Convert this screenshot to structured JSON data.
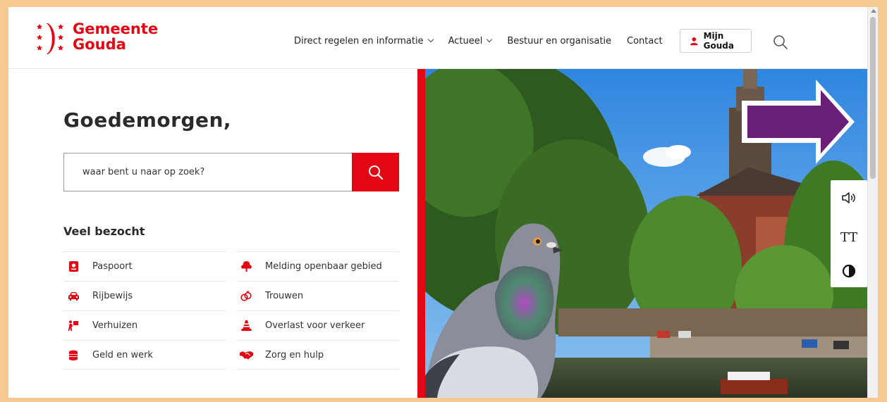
{
  "site": {
    "logo_line1": "Gemeente",
    "logo_line2": "Gouda",
    "brand_color": "#e30613"
  },
  "nav": {
    "items": [
      {
        "label": "Direct regelen en informatie",
        "has_dropdown": true
      },
      {
        "label": "Actueel",
        "has_dropdown": true
      },
      {
        "label": "Bestuur en organisatie",
        "has_dropdown": false
      },
      {
        "label": "Contact",
        "has_dropdown": false
      }
    ],
    "account_button": "Mijn Gouda",
    "account_icon": "user-icon",
    "search_icon": "search-icon"
  },
  "main": {
    "greeting": "Goedemorgen,",
    "search_placeholder": "waar bent u naar op zoek?",
    "popular_title": "Veel bezocht",
    "popular_left": [
      {
        "label": "Paspoort",
        "icon": "passport-icon"
      },
      {
        "label": "Rijbewijs",
        "icon": "car-icon"
      },
      {
        "label": "Verhuizen",
        "icon": "moving-icon"
      },
      {
        "label": "Geld en werk",
        "icon": "coins-icon"
      }
    ],
    "popular_right": [
      {
        "label": "Melding openbaar gebied",
        "icon": "tree-icon"
      },
      {
        "label": "Trouwen",
        "icon": "rings-icon"
      },
      {
        "label": "Overlast voor verkeer",
        "icon": "traffic-cone-icon"
      },
      {
        "label": "Zorg en hulp",
        "icon": "handshake-icon"
      }
    ]
  },
  "accessibility_tools": [
    {
      "name": "speaker-icon"
    },
    {
      "name": "text-size-icon",
      "text": "TT"
    },
    {
      "name": "contrast-icon"
    }
  ]
}
